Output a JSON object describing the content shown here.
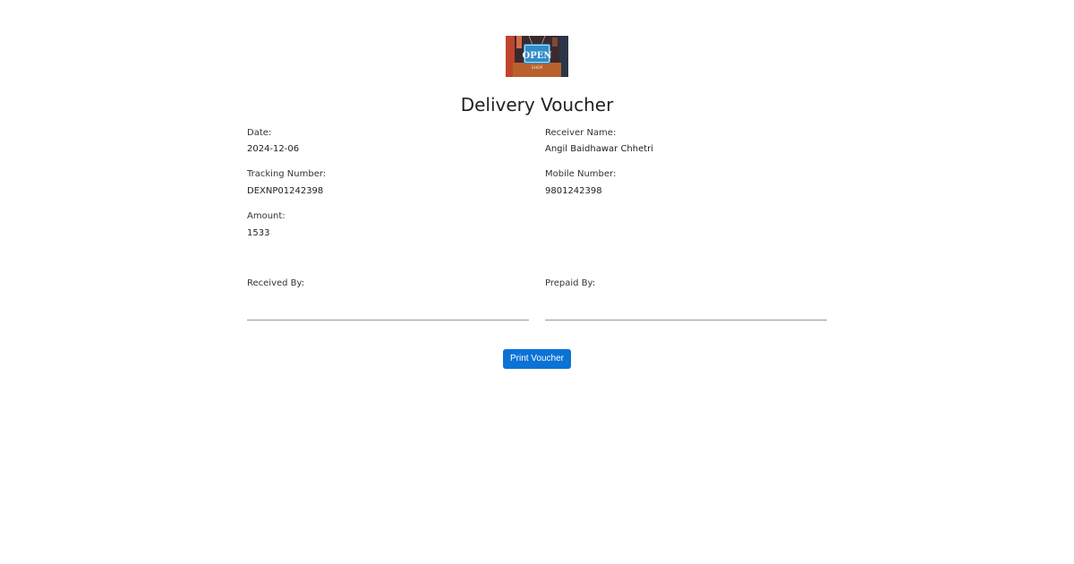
{
  "logo": {
    "icon": "open-shop-sign-image",
    "sign_text": "OPEN",
    "sub_text": "SHOP"
  },
  "title": "Delivery Voucher",
  "fields": {
    "date": {
      "label": "Date:",
      "value": "2024-12-06"
    },
    "receiver_name": {
      "label": "Receiver Name:",
      "value": "Angil Baidhawar Chhetri"
    },
    "tracking_number": {
      "label": "Tracking Number:",
      "value": "DEXNP01242398"
    },
    "mobile_number": {
      "label": "Mobile Number:",
      "value": "9801242398"
    },
    "amount": {
      "label": "Amount:",
      "value": "1533"
    }
  },
  "signatures": {
    "received_by": "Received By:",
    "prepaid_by": "Prepaid By:"
  },
  "print_button": "Print Voucher",
  "colors": {
    "button": "#0b72d6",
    "signature_line": "#9a9a9a"
  }
}
